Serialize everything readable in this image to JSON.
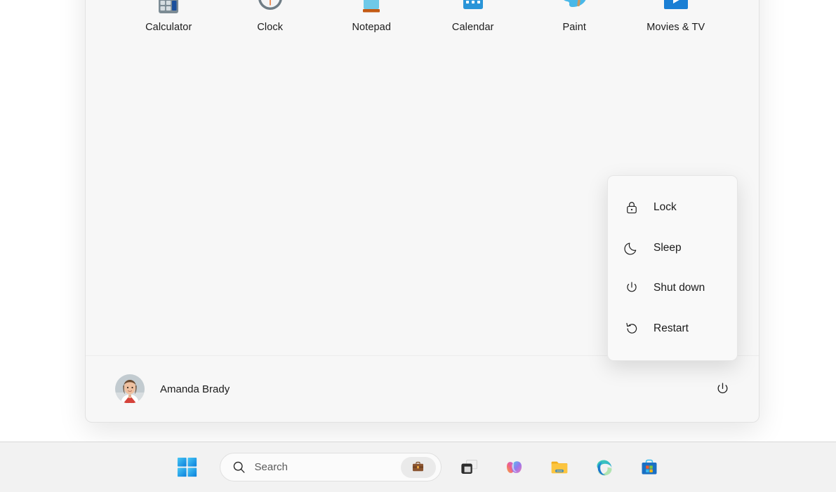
{
  "start_menu": {
    "apps": [
      {
        "label": "Calculator",
        "icon": "calculator-icon"
      },
      {
        "label": "Clock",
        "icon": "clock-icon"
      },
      {
        "label": "Notepad",
        "icon": "notepad-icon"
      },
      {
        "label": "Calendar",
        "icon": "calendar-icon"
      },
      {
        "label": "Paint",
        "icon": "paint-icon"
      },
      {
        "label": "Movies & TV",
        "icon": "movies-tv-icon"
      }
    ],
    "user": {
      "name": "Amanda Brady",
      "avatar": "user-avatar"
    },
    "power_button_icon": "power-icon"
  },
  "power_flyout": {
    "items": [
      {
        "label": "Lock",
        "icon": "lock-icon"
      },
      {
        "label": "Sleep",
        "icon": "moon-icon"
      },
      {
        "label": "Shut down",
        "icon": "power-icon"
      },
      {
        "label": "Restart",
        "icon": "restart-icon"
      }
    ]
  },
  "taskbar": {
    "start_label": "Start",
    "search": {
      "placeholder": "Search",
      "icon": "search-icon",
      "work_badge_icon": "briefcase-icon"
    },
    "buttons": [
      {
        "name": "task-view",
        "label": "Task View"
      },
      {
        "name": "copilot",
        "label": "Copilot"
      },
      {
        "name": "file-explorer",
        "label": "File Explorer"
      },
      {
        "name": "microsoft-edge",
        "label": "Microsoft Edge"
      },
      {
        "name": "microsoft-store",
        "label": "Microsoft Store"
      }
    ]
  },
  "colors": {
    "panel_bg": "#f7f7f7",
    "flyout_bg": "#f9f9f9",
    "taskbar_bg": "#f2f2f2",
    "text": "#1b1b1b",
    "accent_blue": "#0078d4"
  }
}
